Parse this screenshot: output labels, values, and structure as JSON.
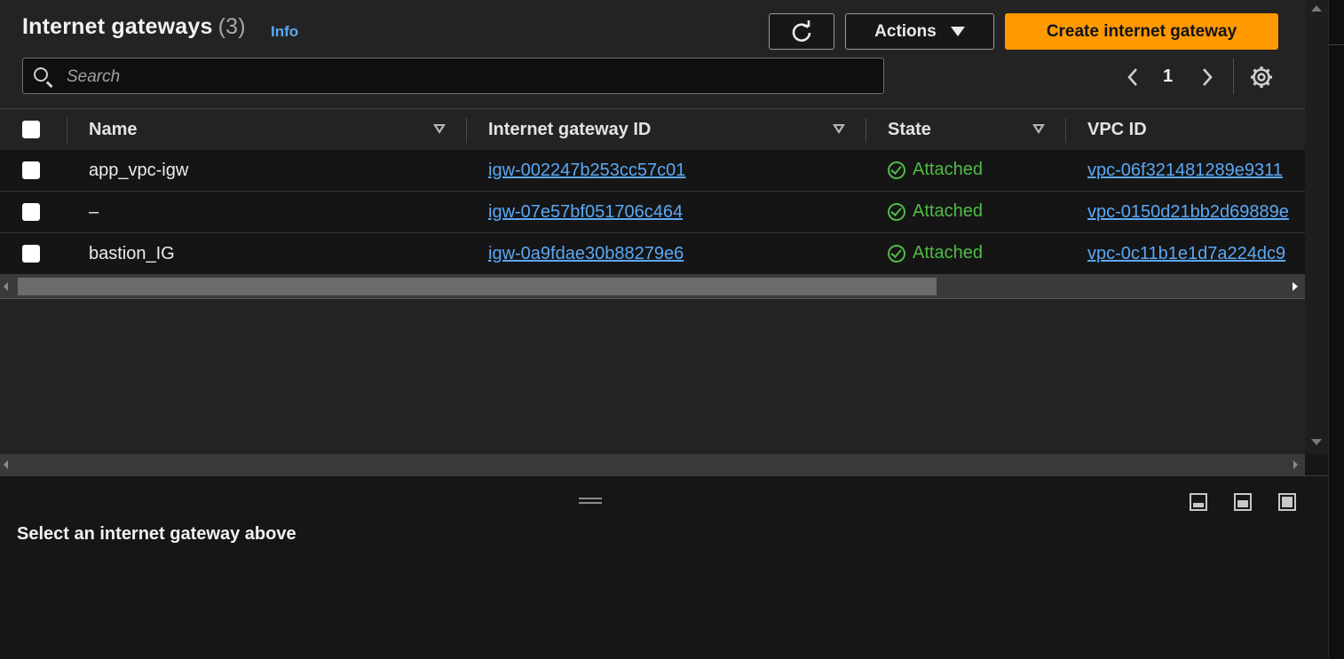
{
  "header": {
    "title": "Internet gateways",
    "count": "(3)",
    "info_link": "Info",
    "refresh_icon": "refresh-icon",
    "actions_label": "Actions",
    "create_label": "Create internet gateway"
  },
  "search": {
    "placeholder": "Search",
    "value": ""
  },
  "pagination": {
    "current_page": "1"
  },
  "table": {
    "columns": [
      "Name",
      "Internet gateway ID",
      "State",
      "VPC ID"
    ],
    "rows": [
      {
        "name": "app_vpc-igw",
        "id": "igw-002247b253cc57c01",
        "state": "Attached",
        "vpc": "vpc-06f321481289e9311"
      },
      {
        "name": "–",
        "id": "igw-07e57bf051706c464",
        "state": "Attached",
        "vpc": "vpc-0150d21bb2d69889e"
      },
      {
        "name": "bastion_IG",
        "id": "igw-0a9fdae30b88279e6",
        "state": "Attached",
        "vpc": "vpc-0c11b1e1d7a224dc9"
      }
    ]
  },
  "detail_panel": {
    "message": "Select an internet gateway above"
  },
  "colors": {
    "accent": "#ff9900",
    "link": "#5ba8f5",
    "success": "#4fbb47",
    "background": "#232323"
  }
}
